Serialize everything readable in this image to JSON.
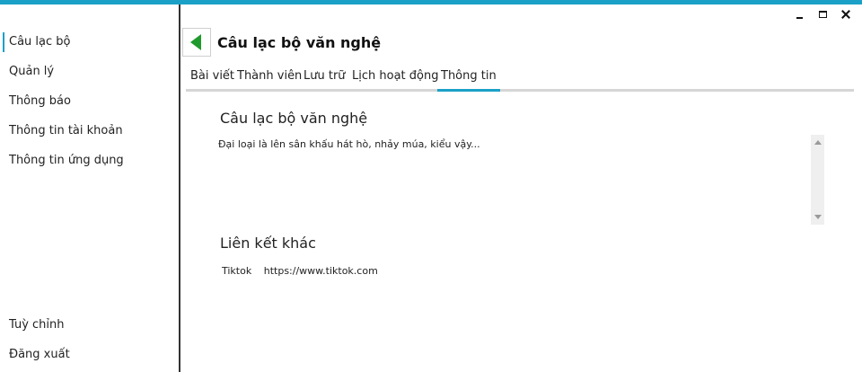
{
  "window": {
    "controls": [
      {
        "name": "minimize",
        "icon": "minimize-icon"
      },
      {
        "name": "maximize",
        "icon": "maximize-icon"
      },
      {
        "name": "close",
        "icon": "close-icon"
      }
    ]
  },
  "colors": {
    "accent": "#1ba1c7",
    "back_arrow": "#1f9a2c"
  },
  "sidebar": {
    "items": [
      {
        "label": "Câu lạc bộ",
        "active": true
      },
      {
        "label": "Quản lý",
        "active": false
      },
      {
        "label": "Thông báo",
        "active": false
      },
      {
        "label": "Thông tin tài khoản",
        "active": false
      },
      {
        "label": "Thông tin ứng dụng",
        "active": false
      }
    ],
    "bottom_items": [
      {
        "label": "Tuỳ chỉnh"
      },
      {
        "label": "Đăng xuất"
      }
    ]
  },
  "header": {
    "back_icon": "back-arrow-icon",
    "title": "Câu lạc bộ văn nghệ"
  },
  "tabs": [
    {
      "label": "Bài viết",
      "active": false
    },
    {
      "label": "Thành viên",
      "active": false
    },
    {
      "label": "Lưu trữ",
      "active": false
    },
    {
      "label": "Lịch hoạt động",
      "active": false
    },
    {
      "label": "Thông tin",
      "active": true
    }
  ],
  "info": {
    "club_name": "Câu lạc bộ văn nghệ",
    "description": "Đại loại là lên sân khấu hát hò, nhảy múa, kiểu vậy...",
    "links_title": "Liên kết khác",
    "links": [
      {
        "platform": "Tiktok",
        "url": "https://www.tiktok.com"
      }
    ]
  }
}
